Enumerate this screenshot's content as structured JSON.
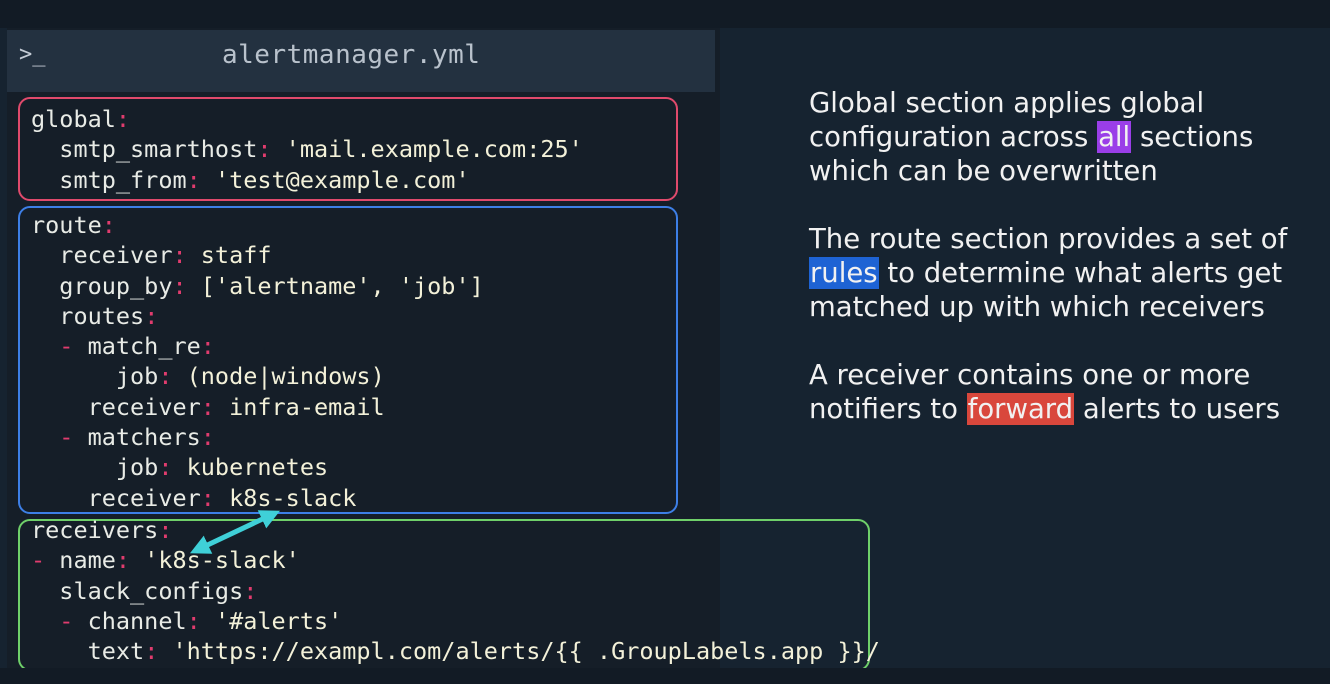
{
  "editor": {
    "prompt_icon": ">_",
    "filename": "alertmanager.yml"
  },
  "code": {
    "global": [
      [
        {
          "t": "global",
          "c": "k"
        },
        {
          "t": ":",
          "c": "p"
        }
      ],
      [
        {
          "t": "  smtp_smarthost",
          "c": "k"
        },
        {
          "t": ": ",
          "c": "p"
        },
        {
          "t": "'mail.example.com:25'",
          "c": "v"
        }
      ],
      [
        {
          "t": "  smtp_from",
          "c": "k"
        },
        {
          "t": ": ",
          "c": "p"
        },
        {
          "t": "'test@example.com'",
          "c": "v"
        }
      ]
    ],
    "route": [
      [
        {
          "t": "route",
          "c": "k"
        },
        {
          "t": ":",
          "c": "p"
        }
      ],
      [
        {
          "t": "  receiver",
          "c": "k"
        },
        {
          "t": ": ",
          "c": "p"
        },
        {
          "t": "staff",
          "c": "v"
        }
      ],
      [
        {
          "t": "  group_by",
          "c": "k"
        },
        {
          "t": ": ",
          "c": "p"
        },
        {
          "t": "['alertname', 'job']",
          "c": "v"
        }
      ],
      [
        {
          "t": "  routes",
          "c": "k"
        },
        {
          "t": ":",
          "c": "p"
        }
      ],
      [
        {
          "t": "  - ",
          "c": "p"
        },
        {
          "t": "match_re",
          "c": "k"
        },
        {
          "t": ":",
          "c": "p"
        }
      ],
      [
        {
          "t": "      job",
          "c": "k"
        },
        {
          "t": ": ",
          "c": "p"
        },
        {
          "t": "(node|windows)",
          "c": "v"
        }
      ],
      [
        {
          "t": "    receiver",
          "c": "k"
        },
        {
          "t": ": ",
          "c": "p"
        },
        {
          "t": "infra-email",
          "c": "v"
        }
      ],
      [
        {
          "t": "  - ",
          "c": "p"
        },
        {
          "t": "matchers",
          "c": "k"
        },
        {
          "t": ":",
          "c": "p"
        }
      ],
      [
        {
          "t": "      job",
          "c": "k"
        },
        {
          "t": ": ",
          "c": "p"
        },
        {
          "t": "kubernetes",
          "c": "v"
        }
      ],
      [
        {
          "t": "    receiver",
          "c": "k"
        },
        {
          "t": ": ",
          "c": "p"
        },
        {
          "t": "k8s-slack",
          "c": "v"
        }
      ]
    ],
    "receivers": [
      [
        {
          "t": "receivers",
          "c": "k"
        },
        {
          "t": ":",
          "c": "p"
        }
      ],
      [
        {
          "t": "- ",
          "c": "p"
        },
        {
          "t": "name",
          "c": "k"
        },
        {
          "t": ": ",
          "c": "p"
        },
        {
          "t": "'k8s-slack'",
          "c": "v"
        }
      ],
      [
        {
          "t": "  slack_configs",
          "c": "k"
        },
        {
          "t": ":",
          "c": "p"
        }
      ],
      [
        {
          "t": "  - ",
          "c": "p"
        },
        {
          "t": "channel",
          "c": "k"
        },
        {
          "t": ": ",
          "c": "p"
        },
        {
          "t": "'#alerts'",
          "c": "v"
        }
      ],
      [
        {
          "t": "    text",
          "c": "k"
        },
        {
          "t": ": ",
          "c": "p"
        },
        {
          "t": "'https://exampl.com/alerts/{{ .GroupLabels.app }}/",
          "c": "v"
        }
      ]
    ]
  },
  "notes": {
    "p1_before": "Global section applies global configuration across ",
    "p1_highlight": "all",
    "p1_after": " sections which can be overwritten",
    "p2_before": "The route section provides a set of ",
    "p2_highlight": "rules",
    "p2_after": " to determine what alerts get matched up with which receivers",
    "p3_before": "A receiver contains one or more notifiers to ",
    "p3_highlight": "forward",
    "p3_after": " alerts to users"
  },
  "colors": {
    "global_box": "#e04a6c",
    "route_box": "#3d7fe6",
    "receivers_box": "#6fd06a",
    "arrow": "#3fd0d8",
    "highlight_all": "#9a3ee8",
    "highlight_rules": "#1e63d4",
    "highlight_forward": "#d9473c"
  }
}
